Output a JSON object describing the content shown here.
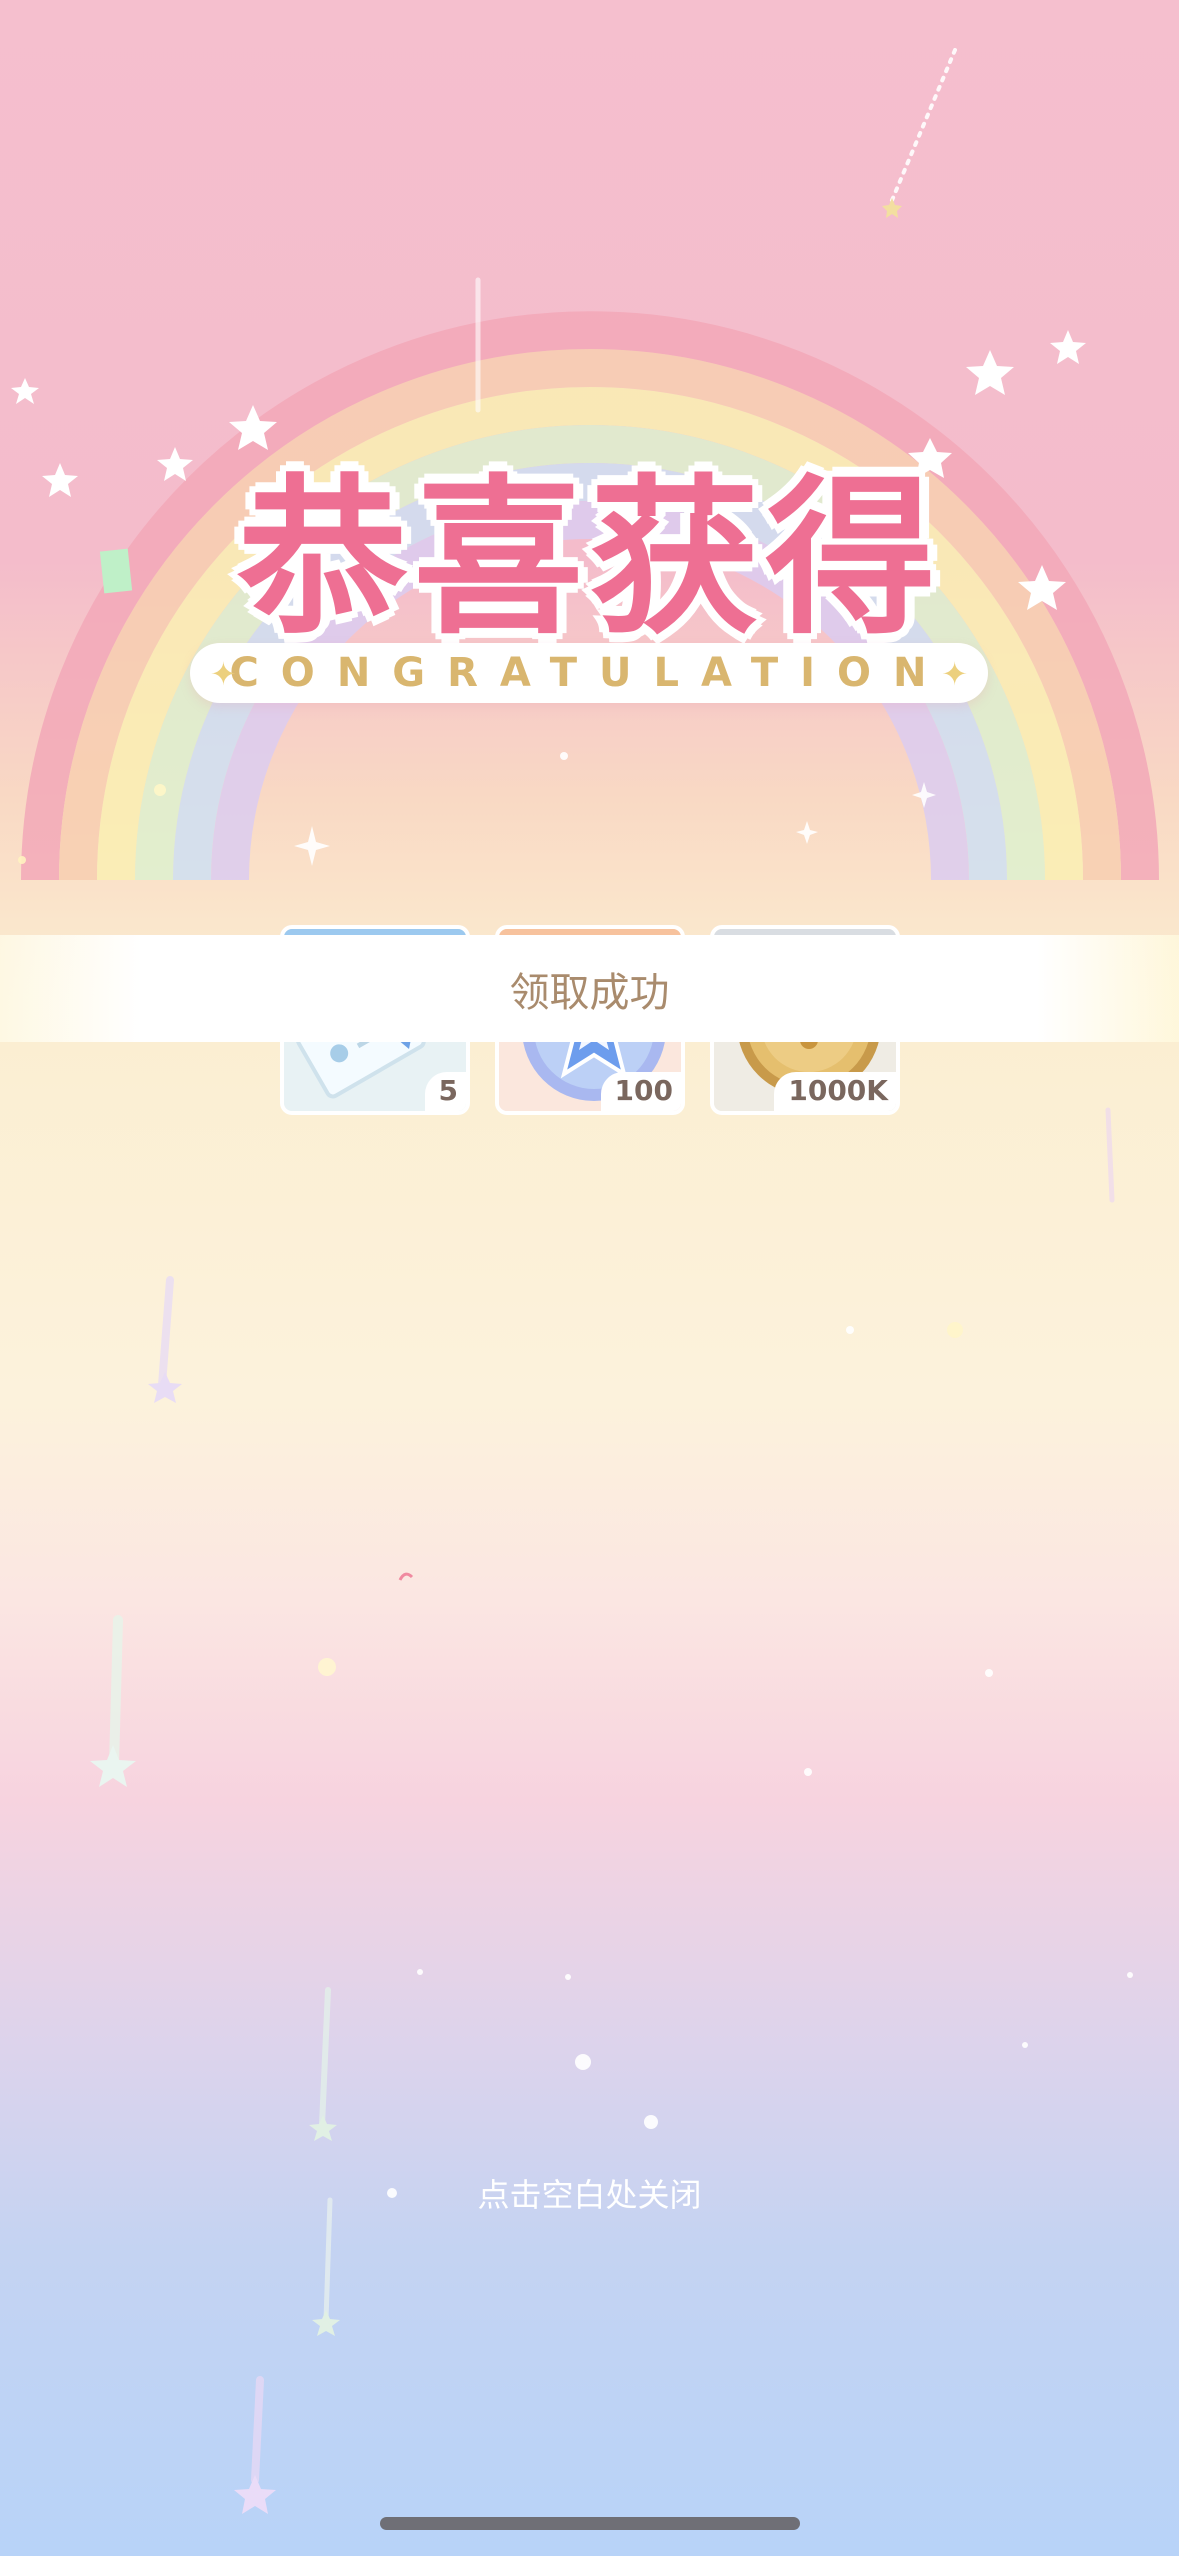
{
  "title": "恭喜获得",
  "subtitle": "CONGRATULATION",
  "banner_text": "领取成功",
  "rewards": [
    {
      "name": "ticket",
      "count": "5",
      "icon": "ticket-icon"
    },
    {
      "name": "star-medal",
      "count": "100",
      "icon": "star-medal-icon"
    },
    {
      "name": "gold-coin",
      "count": "1000K",
      "icon": "gold-coin-icon"
    }
  ],
  "close_hint": "点击空白处关闭",
  "colors": {
    "title_pink": "#ee6f93",
    "subtitle_gold": "#d9b66f",
    "banner_text": "#a98b6d"
  }
}
